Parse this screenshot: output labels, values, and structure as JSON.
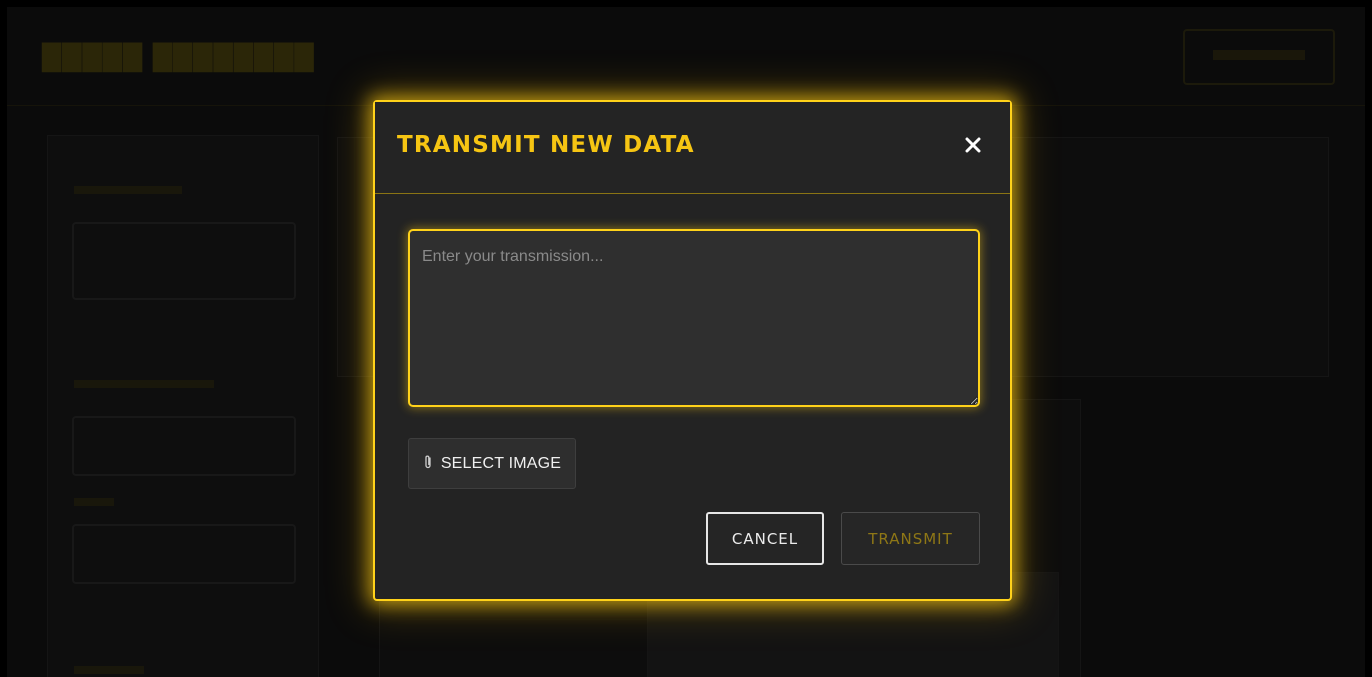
{
  "modal": {
    "title": "TRANSMIT NEW DATA",
    "close_icon": "close-icon",
    "textarea_placeholder": "Enter your transmission...",
    "textarea_value": "",
    "select_image_label": "SELECT IMAGE",
    "select_image_icon": "paperclip-icon",
    "cancel_label": "CANCEL",
    "transmit_label": "TRANSMIT"
  },
  "colors": {
    "accent": "#ffd21a",
    "title": "#f6c513",
    "transmit_disabled_text": "#8e7716",
    "modal_bg": "#232323",
    "overlay_bg": "#0b0b0b"
  }
}
